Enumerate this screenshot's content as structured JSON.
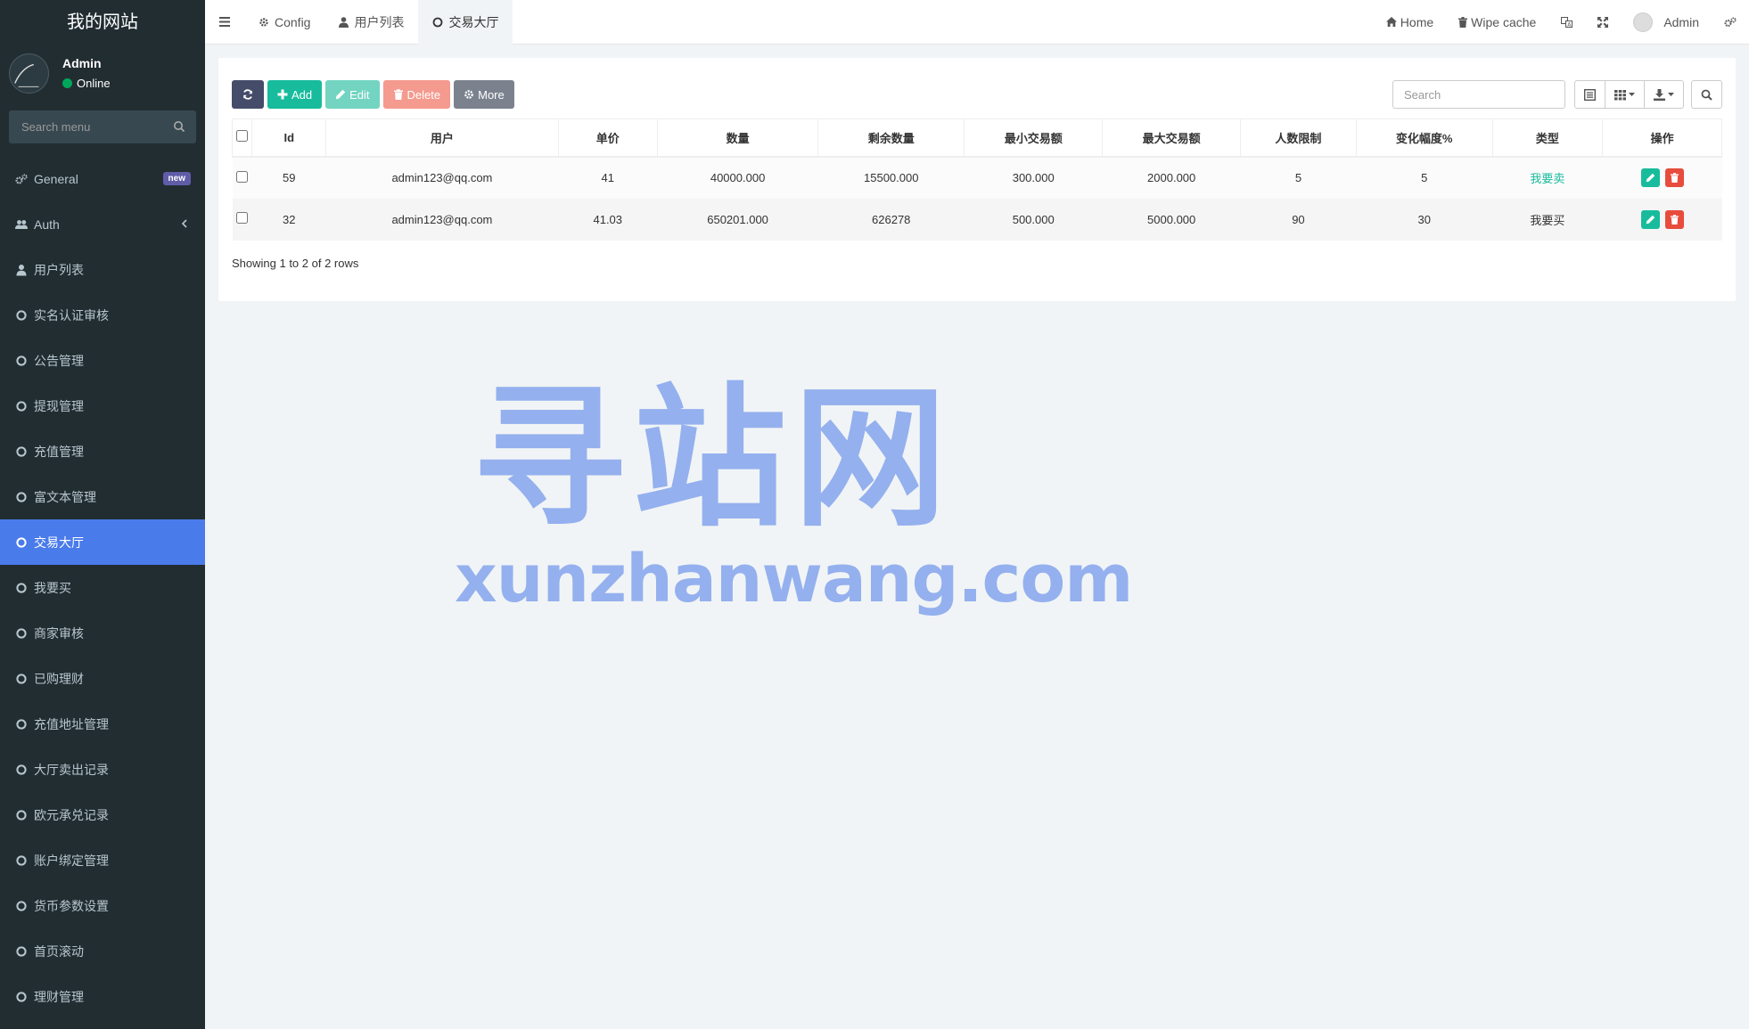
{
  "sidebar": {
    "logo": "我的网站",
    "user": {
      "name": "Admin",
      "status": "Online"
    },
    "search_placeholder": "Search menu",
    "items": [
      {
        "label": "General",
        "icon": "cogs-icon",
        "badge": "new"
      },
      {
        "label": "Auth",
        "icon": "users-icon"
      },
      {
        "label": "用户列表",
        "icon": "user-icon"
      },
      {
        "label": "实名认证审核",
        "icon": "circle-icon"
      },
      {
        "label": "公告管理",
        "icon": "circle-icon"
      },
      {
        "label": "提现管理",
        "icon": "circle-icon"
      },
      {
        "label": "充值管理",
        "icon": "circle-icon"
      },
      {
        "label": "富文本管理",
        "icon": "circle-icon"
      },
      {
        "label": "交易大厅",
        "icon": "circle-icon",
        "active": true
      },
      {
        "label": "我要买",
        "icon": "circle-icon"
      },
      {
        "label": "商家审核",
        "icon": "circle-icon"
      },
      {
        "label": "已购理财",
        "icon": "circle-icon"
      },
      {
        "label": "充值地址管理",
        "icon": "circle-icon"
      },
      {
        "label": "大厅卖出记录",
        "icon": "circle-icon"
      },
      {
        "label": "欧元承兑记录",
        "icon": "circle-icon"
      },
      {
        "label": "账户绑定管理",
        "icon": "circle-icon"
      },
      {
        "label": "货币参数设置",
        "icon": "circle-icon"
      },
      {
        "label": "首页滚动",
        "icon": "circle-icon"
      },
      {
        "label": "理财管理",
        "icon": "circle-icon"
      }
    ]
  },
  "topnav": {
    "tabs": [
      {
        "label": "Config",
        "icon": "gear-icon"
      },
      {
        "label": "用户列表",
        "icon": "user-icon"
      },
      {
        "label": "交易大厅",
        "icon": "circle-icon",
        "active": true
      }
    ],
    "home": "Home",
    "wipe_cache": "Wipe cache",
    "admin": "Admin"
  },
  "toolbar": {
    "add": "Add",
    "edit": "Edit",
    "delete": "Delete",
    "more": "More",
    "search_placeholder": "Search"
  },
  "table": {
    "headers": [
      "Id",
      "用户",
      "单价",
      "数量",
      "剩余数量",
      "最小交易额",
      "最大交易额",
      "人数限制",
      "变化幅度%",
      "类型",
      "操作"
    ],
    "rows": [
      {
        "id": "59",
        "user": "admin123@qq.com",
        "price": "41",
        "quantity": "40000.000",
        "remaining": "15500.000",
        "min": "300.000",
        "max": "2000.000",
        "limit": "5",
        "change": "5",
        "type": "我要卖"
      },
      {
        "id": "32",
        "user": "admin123@qq.com",
        "price": "41.03",
        "quantity": "650201.000",
        "remaining": "626278",
        "min": "500.000",
        "max": "5000.000",
        "limit": "90",
        "change": "30",
        "type": "我要买"
      }
    ]
  },
  "pagination": {
    "info": "Showing 1 to 2 of 2 rows"
  },
  "watermark": {
    "cn": "寻站网",
    "en": "xunzhanwang.com"
  },
  "colors": {
    "sidebar_bg": "#222d32",
    "active": "#4a7bea",
    "success": "#18bc9c",
    "danger": "#e74c3c"
  }
}
